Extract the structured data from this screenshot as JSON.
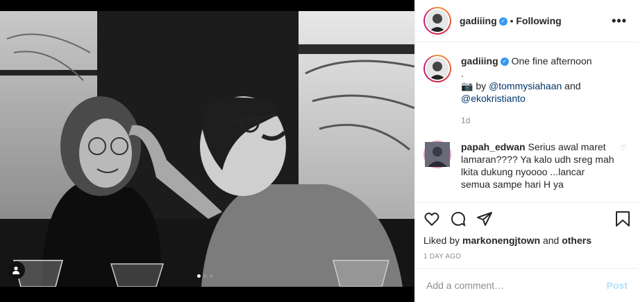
{
  "post": {
    "username": "gadiiing",
    "follow_separator": "•",
    "follow_status": "Following",
    "more_label": "•••",
    "caption_line1": "One fine afternoon",
    "caption_line2": ".",
    "camera_glyph": "📷",
    "credit_by": "by",
    "credit_user1": "@tommysiahaan",
    "credit_and": "and",
    "credit_user2": "@ekokristianto",
    "caption_age": "1d",
    "comment_user": "papah_edwan",
    "comment_text": "Serius awal maret lamaran???? Ya kalo udh sreg mah lkita dukung nyoooo ...lancar semua sampe hari H ya",
    "liked_prefix": "Liked by",
    "liked_user": "markonengjtown",
    "liked_and": "and",
    "liked_others": "others",
    "post_date": "1 DAY AGO",
    "comment_placeholder": "Add a comment…",
    "post_button": "Post"
  },
  "carousel": {
    "slides": 3,
    "active_index": 0
  },
  "icons": {
    "like": "heart-icon",
    "comment": "comment-icon",
    "share": "paper-plane-icon",
    "save": "bookmark-icon",
    "tag": "user-tag-icon",
    "verified": "verified-badge-icon"
  },
  "colors": {
    "verified": "#3897f0",
    "link": "#00376b",
    "muted": "#8e8e8e",
    "post_disabled": "#b2dffc"
  }
}
